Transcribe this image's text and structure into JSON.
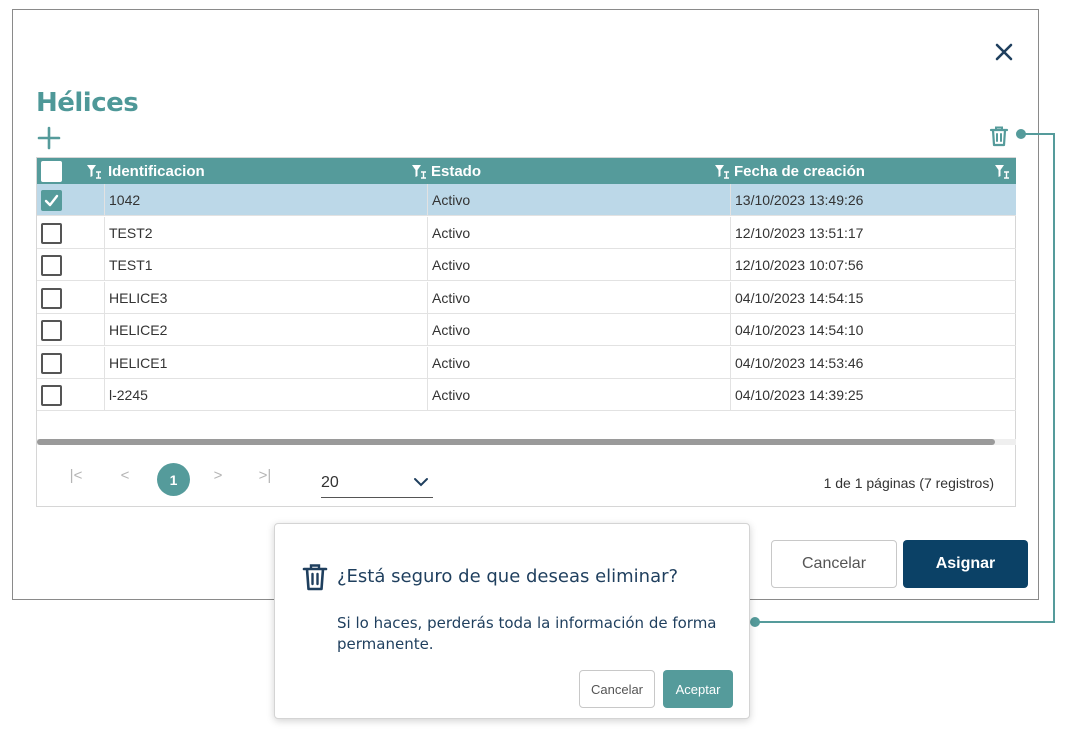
{
  "dialog": {
    "title": "Hélices",
    "close_icon": "close-icon",
    "add_icon": "plus-icon",
    "delete_icon": "trash-icon"
  },
  "table": {
    "columns": [
      "Identificacion",
      "Estado",
      "Fecha de creación"
    ],
    "rows": [
      {
        "checked": true,
        "id": "1042",
        "estado": "Activo",
        "fecha": "13/10/2023 13:49:26"
      },
      {
        "checked": false,
        "id": "TEST2",
        "estado": "Activo",
        "fecha": "12/10/2023 13:51:17"
      },
      {
        "checked": false,
        "id": "TEST1",
        "estado": "Activo",
        "fecha": "12/10/2023 10:07:56"
      },
      {
        "checked": false,
        "id": "HELICE3",
        "estado": "Activo",
        "fecha": "04/10/2023 14:54:15"
      },
      {
        "checked": false,
        "id": "HELICE2",
        "estado": "Activo",
        "fecha": "04/10/2023 14:54:10"
      },
      {
        "checked": false,
        "id": "HELICE1",
        "estado": "Activo",
        "fecha": "04/10/2023 14:53:46"
      },
      {
        "checked": false,
        "id": "l-2245",
        "estado": "Activo",
        "fecha": "04/10/2023 14:39:25"
      }
    ]
  },
  "pager": {
    "first": "|<",
    "prev": "<",
    "current_page": "1",
    "next": ">",
    "last": ">|",
    "page_size": "20",
    "info": "1 de 1 páginas (7 registros)"
  },
  "footer": {
    "cancel_label": "Cancelar",
    "assign_label": "Asignar"
  },
  "confirm": {
    "title": "¿Está seguro de que deseas eliminar?",
    "body": "Si lo haces, perderás toda la información de forma permanente.",
    "cancel_label": "Cancelar",
    "accept_label": "Aceptar"
  },
  "colors": {
    "teal": "#559b9b",
    "navy": "#0b4166",
    "selected_row": "#bcd8e8"
  }
}
